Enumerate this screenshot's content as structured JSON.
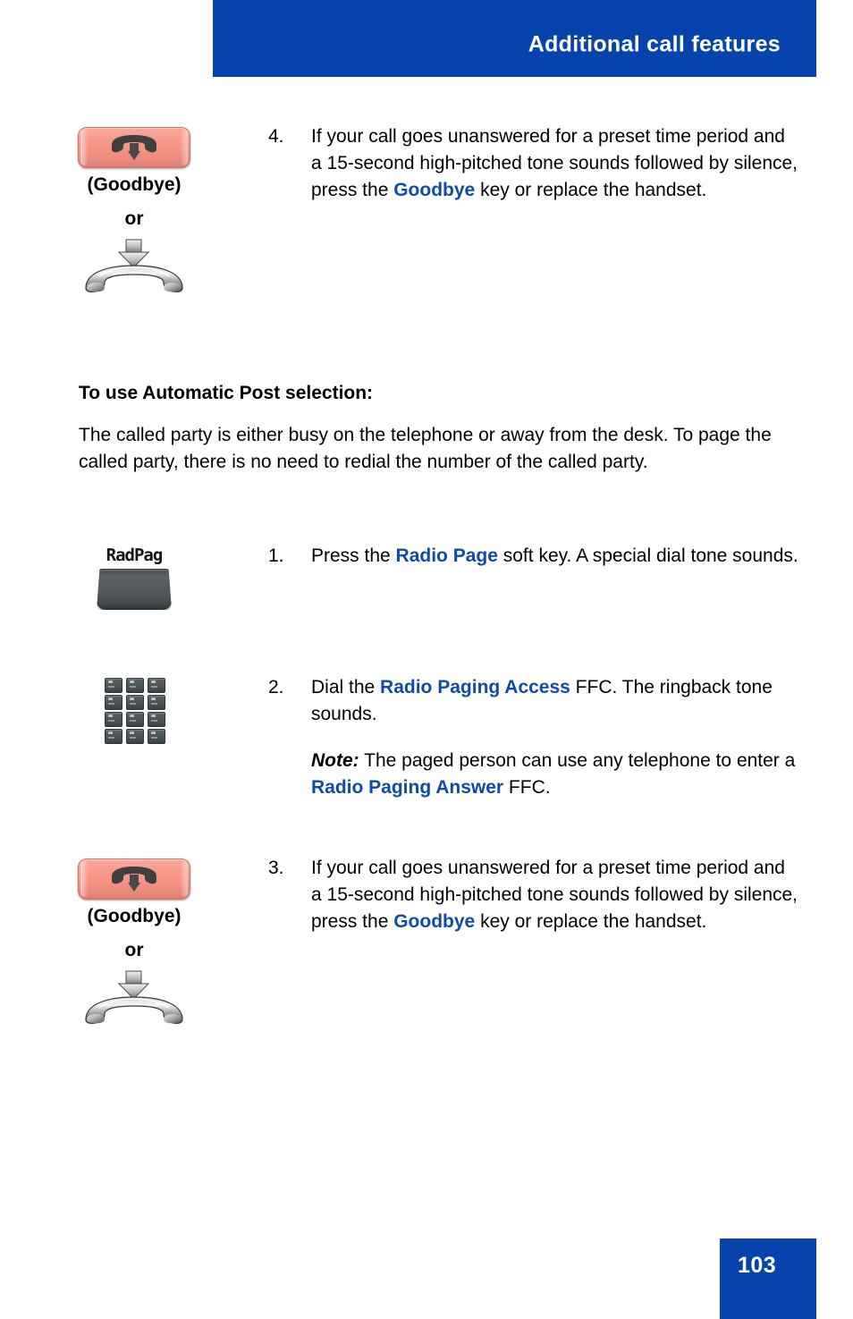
{
  "header": {
    "title": "Additional call features",
    "bar_color": "#0743AC"
  },
  "colors": {
    "accent_blue": "#0743AC",
    "link_blue": "#0F4BA8",
    "goodbye_key_pink": "#F59283",
    "softkey_gray": "#4C5154"
  },
  "step_top": {
    "number": "4.",
    "text_before_link": "If your call goes unanswered for a preset time period and a 15-second high-pitched tone sounds followed by silence, press the ",
    "link": "Goodbye",
    "text_after_link": " key or replace the handset.",
    "icon": {
      "caption": "(Goodbye)",
      "or_label": "or",
      "key_icon_name": "goodbye-key-icon",
      "handset_icon_name": "handset-replace-icon"
    }
  },
  "section": {
    "heading": "To use Automatic Post selection:",
    "paragraph": "The called party is either busy on the telephone or away from the desk. To page the called party, there is no need to redial the number of the called party."
  },
  "steps": [
    {
      "number": "1.",
      "text_before_link": "Press the ",
      "link": "Radio Page",
      "text_after_link": " soft key. A special dial tone sounds.",
      "icon_type": "softkey",
      "softkey_label": "RadPag"
    },
    {
      "number": "2.",
      "text_before_link": "Dial the ",
      "link": "Radio Paging Access",
      "text_after_link": " FFC. The ringback tone sounds.",
      "icon_type": "keypad",
      "note": {
        "label": "Note:",
        "text_before_link": " The paged person can use any telephone to enter a ",
        "link": "Radio Paging Answer",
        "text_after_link": " FFC."
      }
    },
    {
      "number": "3.",
      "text_before_link": "If your call goes unanswered for a preset time period and a 15-second high-pitched tone sounds followed by silence, press the ",
      "link": "Goodbye",
      "text_after_link": " key or replace the handset.",
      "icon_type": "goodbye",
      "icon": {
        "caption": "(Goodbye)",
        "or_label": "or"
      }
    }
  ],
  "footer": {
    "page_number": "103"
  }
}
